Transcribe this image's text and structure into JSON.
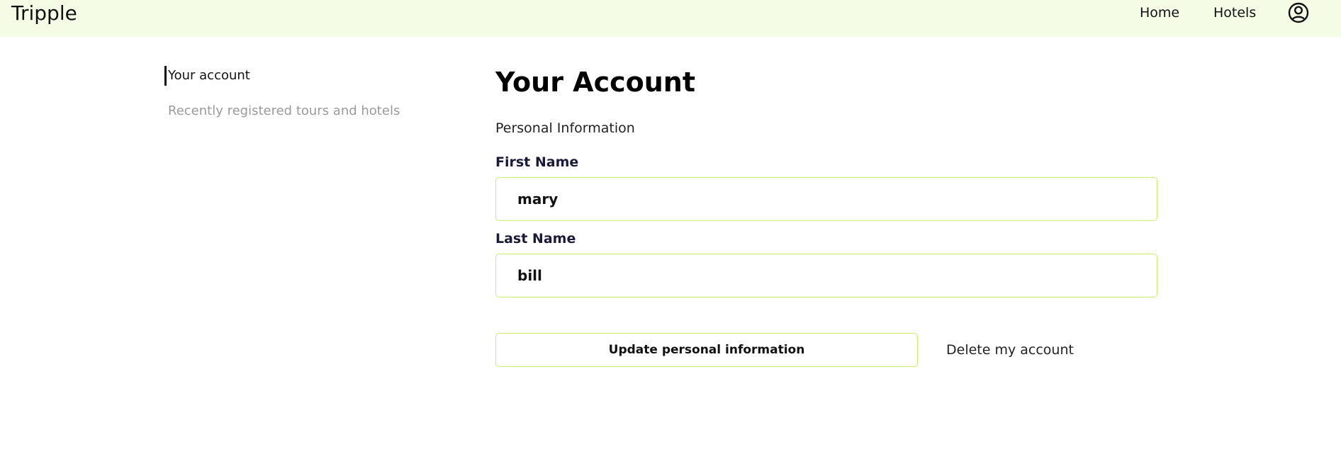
{
  "header": {
    "brand": "Tripple",
    "nav": {
      "home": "Home",
      "hotels": "Hotels"
    },
    "account_icon": "user-circle-icon"
  },
  "sidebar": {
    "items": [
      {
        "label": "Your account",
        "active": true
      },
      {
        "label": "Recently registered tours and hotels",
        "active": false
      }
    ]
  },
  "main": {
    "title": "Your Account",
    "section": "Personal Information",
    "first_name": {
      "label": "First Name",
      "value": "mary"
    },
    "last_name": {
      "label": "Last Name",
      "value": "bill"
    },
    "update_button": "Update personal information",
    "delete_link": "Delete my account"
  },
  "colors": {
    "header_bg": "#f4fce6",
    "accent_border": "#c9f06a"
  }
}
